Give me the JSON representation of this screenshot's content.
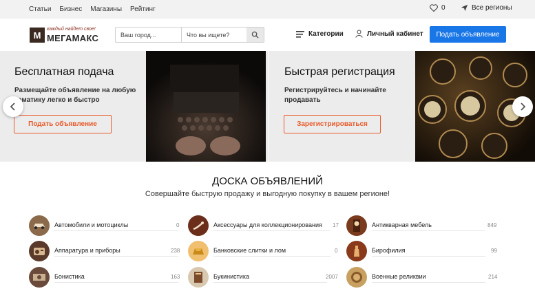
{
  "topbar": {
    "nav": [
      "Статьи",
      "Бизнес",
      "Магазины",
      "Рейтинг"
    ],
    "favorites_count": "0",
    "regions_label": "Все регионы"
  },
  "header": {
    "logo_letter": "М",
    "logo_slogan": "каждый найдет свое!",
    "logo_name": "МЕГАМАКС",
    "city_placeholder": "Ваш город...",
    "query_placeholder": "Что вы ищете?",
    "categories_label": "Категории",
    "cabinet_label": "Личный кабинет",
    "post_ad_label": "Подать объявление"
  },
  "banners": [
    {
      "title": "Бесплатная подача",
      "text_line1": "Размещайте объявление на любую",
      "text_line2": "тематику легко и быстро",
      "button": "Подать объявление"
    },
    {
      "title": "Быстрая регистрация",
      "text_line1": "Регистрируйтесь и начинайте",
      "text_line2": "продавать",
      "button": "Зарегистрироваться"
    }
  ],
  "board": {
    "title": "ДОСКА ОБЪЯВЛЕНИЙ",
    "subtitle": "Совершайте быструю продажу и выгодную покупку в вашем регионе!",
    "categories": [
      {
        "name": "Автомобили и мотоциклы",
        "count": "0",
        "icon": "car-icon",
        "color": "#8a6a4a"
      },
      {
        "name": "Аксессуары для коллекционирования",
        "count": "17",
        "icon": "pipe-icon",
        "color": "#6b2e1a"
      },
      {
        "name": "Антикварная мебель",
        "count": "849",
        "icon": "clock-icon",
        "color": "#7a3a1e"
      },
      {
        "name": "Аппаратура и приборы",
        "count": "238",
        "icon": "radio-icon",
        "color": "#5a3a2a"
      },
      {
        "name": "Банковские слитки и лом",
        "count": "0",
        "icon": "gold-bar-icon",
        "color": "#c98a1a"
      },
      {
        "name": "Бирофилия",
        "count": "99",
        "icon": "beer-icon",
        "color": "#8a3a1a"
      },
      {
        "name": "Бонистика",
        "count": "163",
        "icon": "banknote-icon",
        "color": "#6a4a3a"
      },
      {
        "name": "Букинистика",
        "count": "2007",
        "icon": "book-icon",
        "color": "#7a4a2a"
      },
      {
        "name": "Военные реликвии",
        "count": "214",
        "icon": "medal-icon",
        "color": "#8a5a2a"
      }
    ]
  }
}
